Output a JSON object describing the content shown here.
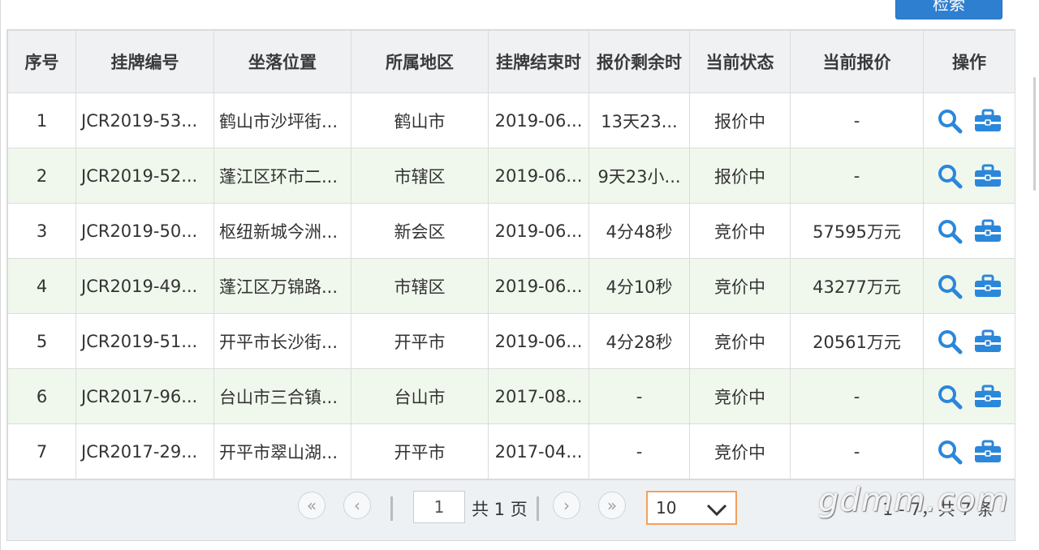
{
  "top_button": {
    "label": "检索"
  },
  "table": {
    "columns": [
      "序号",
      "挂牌编号",
      "坐落位置",
      "所属地区",
      "挂牌结束时",
      "报价剩余时",
      "当前状态",
      "当前报价",
      "操作"
    ],
    "rows": [
      {
        "no": "1",
        "code": "JCR2019-53...",
        "location": "鹤山市沙坪街...",
        "region": "鹤山市",
        "end": "2019-06...",
        "remain": "13天23...",
        "status": "报价中",
        "price": "-"
      },
      {
        "no": "2",
        "code": "JCR2019-52...",
        "location": "蓬江区环市二...",
        "region": "市辖区",
        "end": "2019-06...",
        "remain": "9天23小...",
        "status": "报价中",
        "price": "-"
      },
      {
        "no": "3",
        "code": "JCR2019-50...",
        "location": "枢纽新城今洲...",
        "region": "新会区",
        "end": "2019-06...",
        "remain": "4分48秒",
        "status": "竞价中",
        "price": "57595万元"
      },
      {
        "no": "4",
        "code": "JCR2019-49...",
        "location": "蓬江区万锦路...",
        "region": "市辖区",
        "end": "2019-06...",
        "remain": "4分10秒",
        "status": "竞价中",
        "price": "43277万元"
      },
      {
        "no": "5",
        "code": "JCR2019-51...",
        "location": "开平市长沙街...",
        "region": "开平市",
        "end": "2019-06...",
        "remain": "4分28秒",
        "status": "竞价中",
        "price": "20561万元"
      },
      {
        "no": "6",
        "code": "JCR2017-96...",
        "location": "台山市三合镇...",
        "region": "台山市",
        "end": "2017-08...",
        "remain": "-",
        "status": "竞价中",
        "price": "-"
      },
      {
        "no": "7",
        "code": "JCR2017-29...",
        "location": "开平市翠山湖...",
        "region": "开平市",
        "end": "2017-04...",
        "remain": "-",
        "status": "竞价中",
        "price": "-"
      }
    ],
    "icons": {
      "view": "search-icon",
      "operate": "briefcase-icon"
    }
  },
  "pager": {
    "first": "«",
    "prev": "‹",
    "current_page": "1",
    "total_pages_text": "共 1 页",
    "next": "›",
    "last": "»",
    "page_size": "10",
    "summary": "1 - 7，共 7 条"
  },
  "watermark": "gdmm.com",
  "colors": {
    "accent": "#2f7fd1",
    "icon": "#2b87da",
    "row_alt": "#f0f8ed",
    "select_border": "#f2a05a"
  }
}
